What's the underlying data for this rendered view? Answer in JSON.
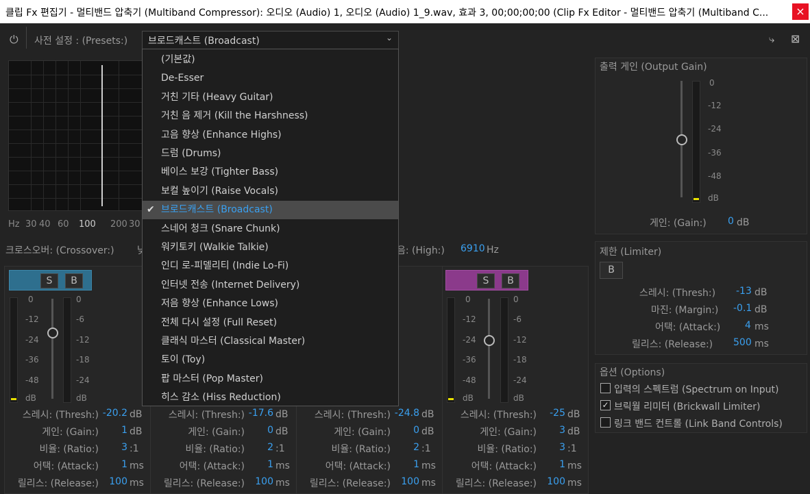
{
  "window": {
    "title": "클립 Fx 편집기 - 멀티밴드 압축기 (Multiband Compressor): 오디오 (Audio) 1, 오디오 (Audio) 1_9.wav, 효과 3, 00;00;00;00 (Clip Fx Editor - 멀티밴드 압축기 (Multiband C...",
    "close": "×"
  },
  "toolbar": {
    "power_icon": "⏻",
    "presets_label": "사전 설정 : (Presets:)",
    "preset_value": "브로드캐스트 (Broadcast)",
    "chevron": "⌄",
    "icon_routing": "⤷",
    "icon_close_editor": "⊠"
  },
  "dropdown": {
    "selected_index": 8,
    "items": [
      "(기본값)",
      "De-Esser",
      "거친 기타 (Heavy Guitar)",
      "거친 음 제거 (Kill the Harshness)",
      "고음 향상 (Enhance Highs)",
      "드럼 (Drums)",
      "베이스 보강 (Tighter Bass)",
      "보컬 높이기 (Raise Vocals)",
      "브로드캐스트 (Broadcast)",
      "스네어 청크 (Snare Chunk)",
      "워키토키 (Walkie Talkie)",
      "인디 로-피델리티 (Indie Lo-Fi)",
      "인터넷 전송 (Internet Delivery)",
      "저음 향상 (Enhance Lows)",
      "전체 다시 설정 (Full Reset)",
      "클래식 마스터 (Classical Master)",
      "토이 (Toy)",
      "팝 마스터 (Pop Master)",
      "히스 감소 (Hiss Reduction)"
    ]
  },
  "graph": {
    "axis": [
      "Hz",
      "30",
      "40",
      "60",
      "100",
      "200",
      "30"
    ]
  },
  "crossover": {
    "label": "크로스오버: (Crossover:)",
    "partial": "낮",
    "high_label_partial": "음: (High:)",
    "high_value": "6910",
    "high_unit": "Hz"
  },
  "bands": [
    {
      "thresh": "-20.2",
      "gain": "1",
      "ratio": "3",
      "attack": "1",
      "release": "100"
    },
    {
      "thresh": "-17.6",
      "gain": "0",
      "ratio": "2",
      "attack": "1",
      "release": "100"
    },
    {
      "thresh": "-24.8",
      "gain": "0",
      "ratio": "2",
      "attack": "1",
      "release": "100"
    },
    {
      "thresh": "-25",
      "gain": "3",
      "ratio": "3",
      "attack": "1",
      "release": "100"
    }
  ],
  "band_labels": {
    "thresh": "스레시: (Thresh:)",
    "gain": "게인: (Gain:)",
    "ratio": "비율: (Ratio:)",
    "attack": "어택: (Attack:)",
    "release": "릴리스: (Release:)",
    "db": "dB",
    "ms": "ms",
    "ratio_suffix": ":1",
    "solo": "S",
    "bypass": "B"
  },
  "meter_scale": [
    "0",
    "-12",
    "-24",
    "-36",
    "-48",
    "dB"
  ],
  "meter_scale_right": [
    "0",
    "-6",
    "-12",
    "-18",
    "-24",
    "dB"
  ],
  "output": {
    "title": "출력 게인 (Output Gain)",
    "gain_label": "게인: (Gain:)",
    "gain_value": "0",
    "gain_unit": "dB",
    "scale": [
      "0",
      "-12",
      "-24",
      "-36",
      "-48",
      "dB"
    ]
  },
  "limiter": {
    "title": "제한 (Limiter)",
    "bypass": "B",
    "thresh_label": "스레시: (Thresh:)",
    "thresh_value": "-13",
    "margin_label": "마진: (Margin:)",
    "margin_value": "-0.1",
    "attack_label": "어택: (Attack:)",
    "attack_value": "4",
    "release_label": "릴리스: (Release:)",
    "release_value": "500",
    "db": "dB",
    "ms": "ms"
  },
  "options": {
    "title": "옵션 (Options)",
    "items": [
      {
        "label": "입력의 스펙트럼 (Spectrum on Input)",
        "checked": ""
      },
      {
        "label": "브릭월 리미터 (Brickwall Limiter)",
        "checked": "✓"
      },
      {
        "label": "링크 밴드 컨트롤 (Link Band Controls)",
        "checked": ""
      }
    ]
  },
  "colors": {
    "accent": "#3aa0f0",
    "band1": "#2e6f8e",
    "band4": "#8b3a8b"
  }
}
